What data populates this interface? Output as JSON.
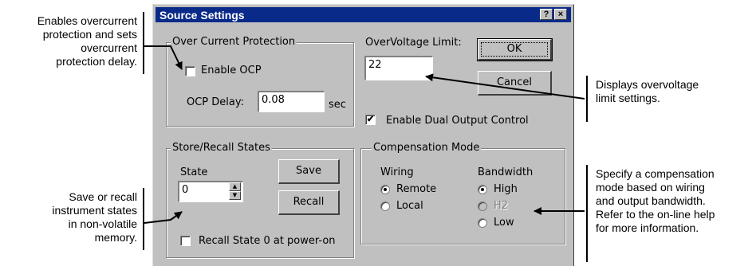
{
  "annotations": {
    "ocp_note": "Enables overcurrent\nprotection and sets\novercurrent\nprotection delay.",
    "ovp_note": "Displays overvoltage\nlimit settings.",
    "state_note": "Save or recall\ninstrument states\nin non-volatile\nmemory.",
    "comp_note": "Specify a compensation\nmode based on wiring\nand output bandwidth.\nRefer to the on-line help\nfor more information."
  },
  "dialog": {
    "title": "Source Settings",
    "help_button": "?",
    "close_button": "×",
    "ocp_group": {
      "label": "Over Current Protection",
      "enable_label": "Enable OCP",
      "enable_checked": false,
      "delay_label": "OCP Delay:",
      "delay_value": "0.08",
      "delay_unit": "sec"
    },
    "ovp": {
      "label": "OverVoltage Limit:",
      "value": "22"
    },
    "ok_label": "OK",
    "cancel_label": "Cancel",
    "dual_output": {
      "label": "Enable Dual Output Control",
      "checked": true
    },
    "store_group": {
      "label": "Store/Recall States",
      "state_label": "State",
      "state_value": "0",
      "save_label": "Save",
      "recall_label": "Recall",
      "recall_poweron_label": "Recall State 0 at power-on",
      "recall_poweron_checked": false
    },
    "comp_group": {
      "label": "Compensation Mode",
      "wiring_label": "Wiring",
      "wiring_options": [
        "Remote",
        "Local"
      ],
      "wiring_selected": "Remote",
      "bandwidth_label": "Bandwidth",
      "bandwidth_options": [
        "High",
        "H2",
        "Low"
      ],
      "bandwidth_selected": "High",
      "bandwidth_disabled": [
        "H2"
      ]
    },
    "check_glyph": "✔",
    "spin_up_icon": "▲",
    "spin_down_icon": "▼"
  }
}
